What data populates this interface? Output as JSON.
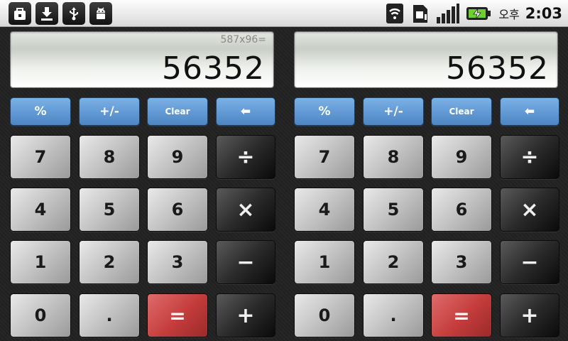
{
  "status_bar": {
    "left_icons": [
      "briefcase-lock-icon",
      "download-icon",
      "usb-icon",
      "android-debug-icon"
    ],
    "right_icons": [
      "wifi-icon",
      "sim-icon",
      "signal-icon",
      "battery-charging-icon"
    ],
    "ampm": "오후",
    "time": "2:03"
  },
  "calculators": [
    {
      "expression": "587x96=",
      "value": "56352",
      "keys": {
        "percent": "%",
        "plus_minus": "+/-",
        "clear": "Clear",
        "backspace": "⬅",
        "seven": "7",
        "eight": "8",
        "nine": "9",
        "divide": "÷",
        "four": "4",
        "five": "5",
        "six": "6",
        "multiply": "×",
        "one": "1",
        "two": "2",
        "three": "3",
        "minus": "−",
        "zero": "0",
        "dot": ".",
        "equals": "=",
        "plus": "+"
      }
    },
    {
      "expression": "",
      "value": "56352",
      "keys": {
        "percent": "%",
        "plus_minus": "+/-",
        "clear": "Clear",
        "backspace": "⬅",
        "seven": "7",
        "eight": "8",
        "nine": "9",
        "divide": "÷",
        "four": "4",
        "five": "5",
        "six": "6",
        "multiply": "×",
        "one": "1",
        "two": "2",
        "three": "3",
        "minus": "−",
        "zero": "0",
        "dot": ".",
        "equals": "=",
        "plus": "+"
      }
    }
  ],
  "colors": {
    "function_key": "#5b93d0",
    "equals_key": "#c94444",
    "operator_key": "#222222",
    "number_key": "#c4c4c4"
  }
}
